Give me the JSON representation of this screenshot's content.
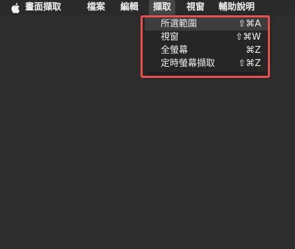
{
  "menubar": {
    "apple_icon": "apple-logo-icon",
    "items": [
      {
        "label": "畫面擷取"
      },
      {
        "label": "檔案"
      },
      {
        "label": "編輯"
      },
      {
        "label": "擷取",
        "active": true
      },
      {
        "label": "視窗"
      },
      {
        "label": "輔助說明"
      }
    ]
  },
  "capture_menu": {
    "items": [
      {
        "label": "所選範圍",
        "shortcut": "⇧⌘A",
        "highlighted": true
      },
      {
        "label": "視窗",
        "shortcut": "⇧⌘W"
      },
      {
        "label": "全螢幕",
        "shortcut": "⌘Z"
      },
      {
        "label": "定時螢幕擷取",
        "shortcut": "⇧⌘Z"
      }
    ]
  },
  "colors": {
    "background": "#2d2d2d",
    "menubar": "#2a2a2a",
    "active_menu": "#474747",
    "dropdown": "#262626",
    "highlight_row": "#3d3d3d",
    "annotation_box": "#e8514f",
    "text": "#eeeeee"
  }
}
